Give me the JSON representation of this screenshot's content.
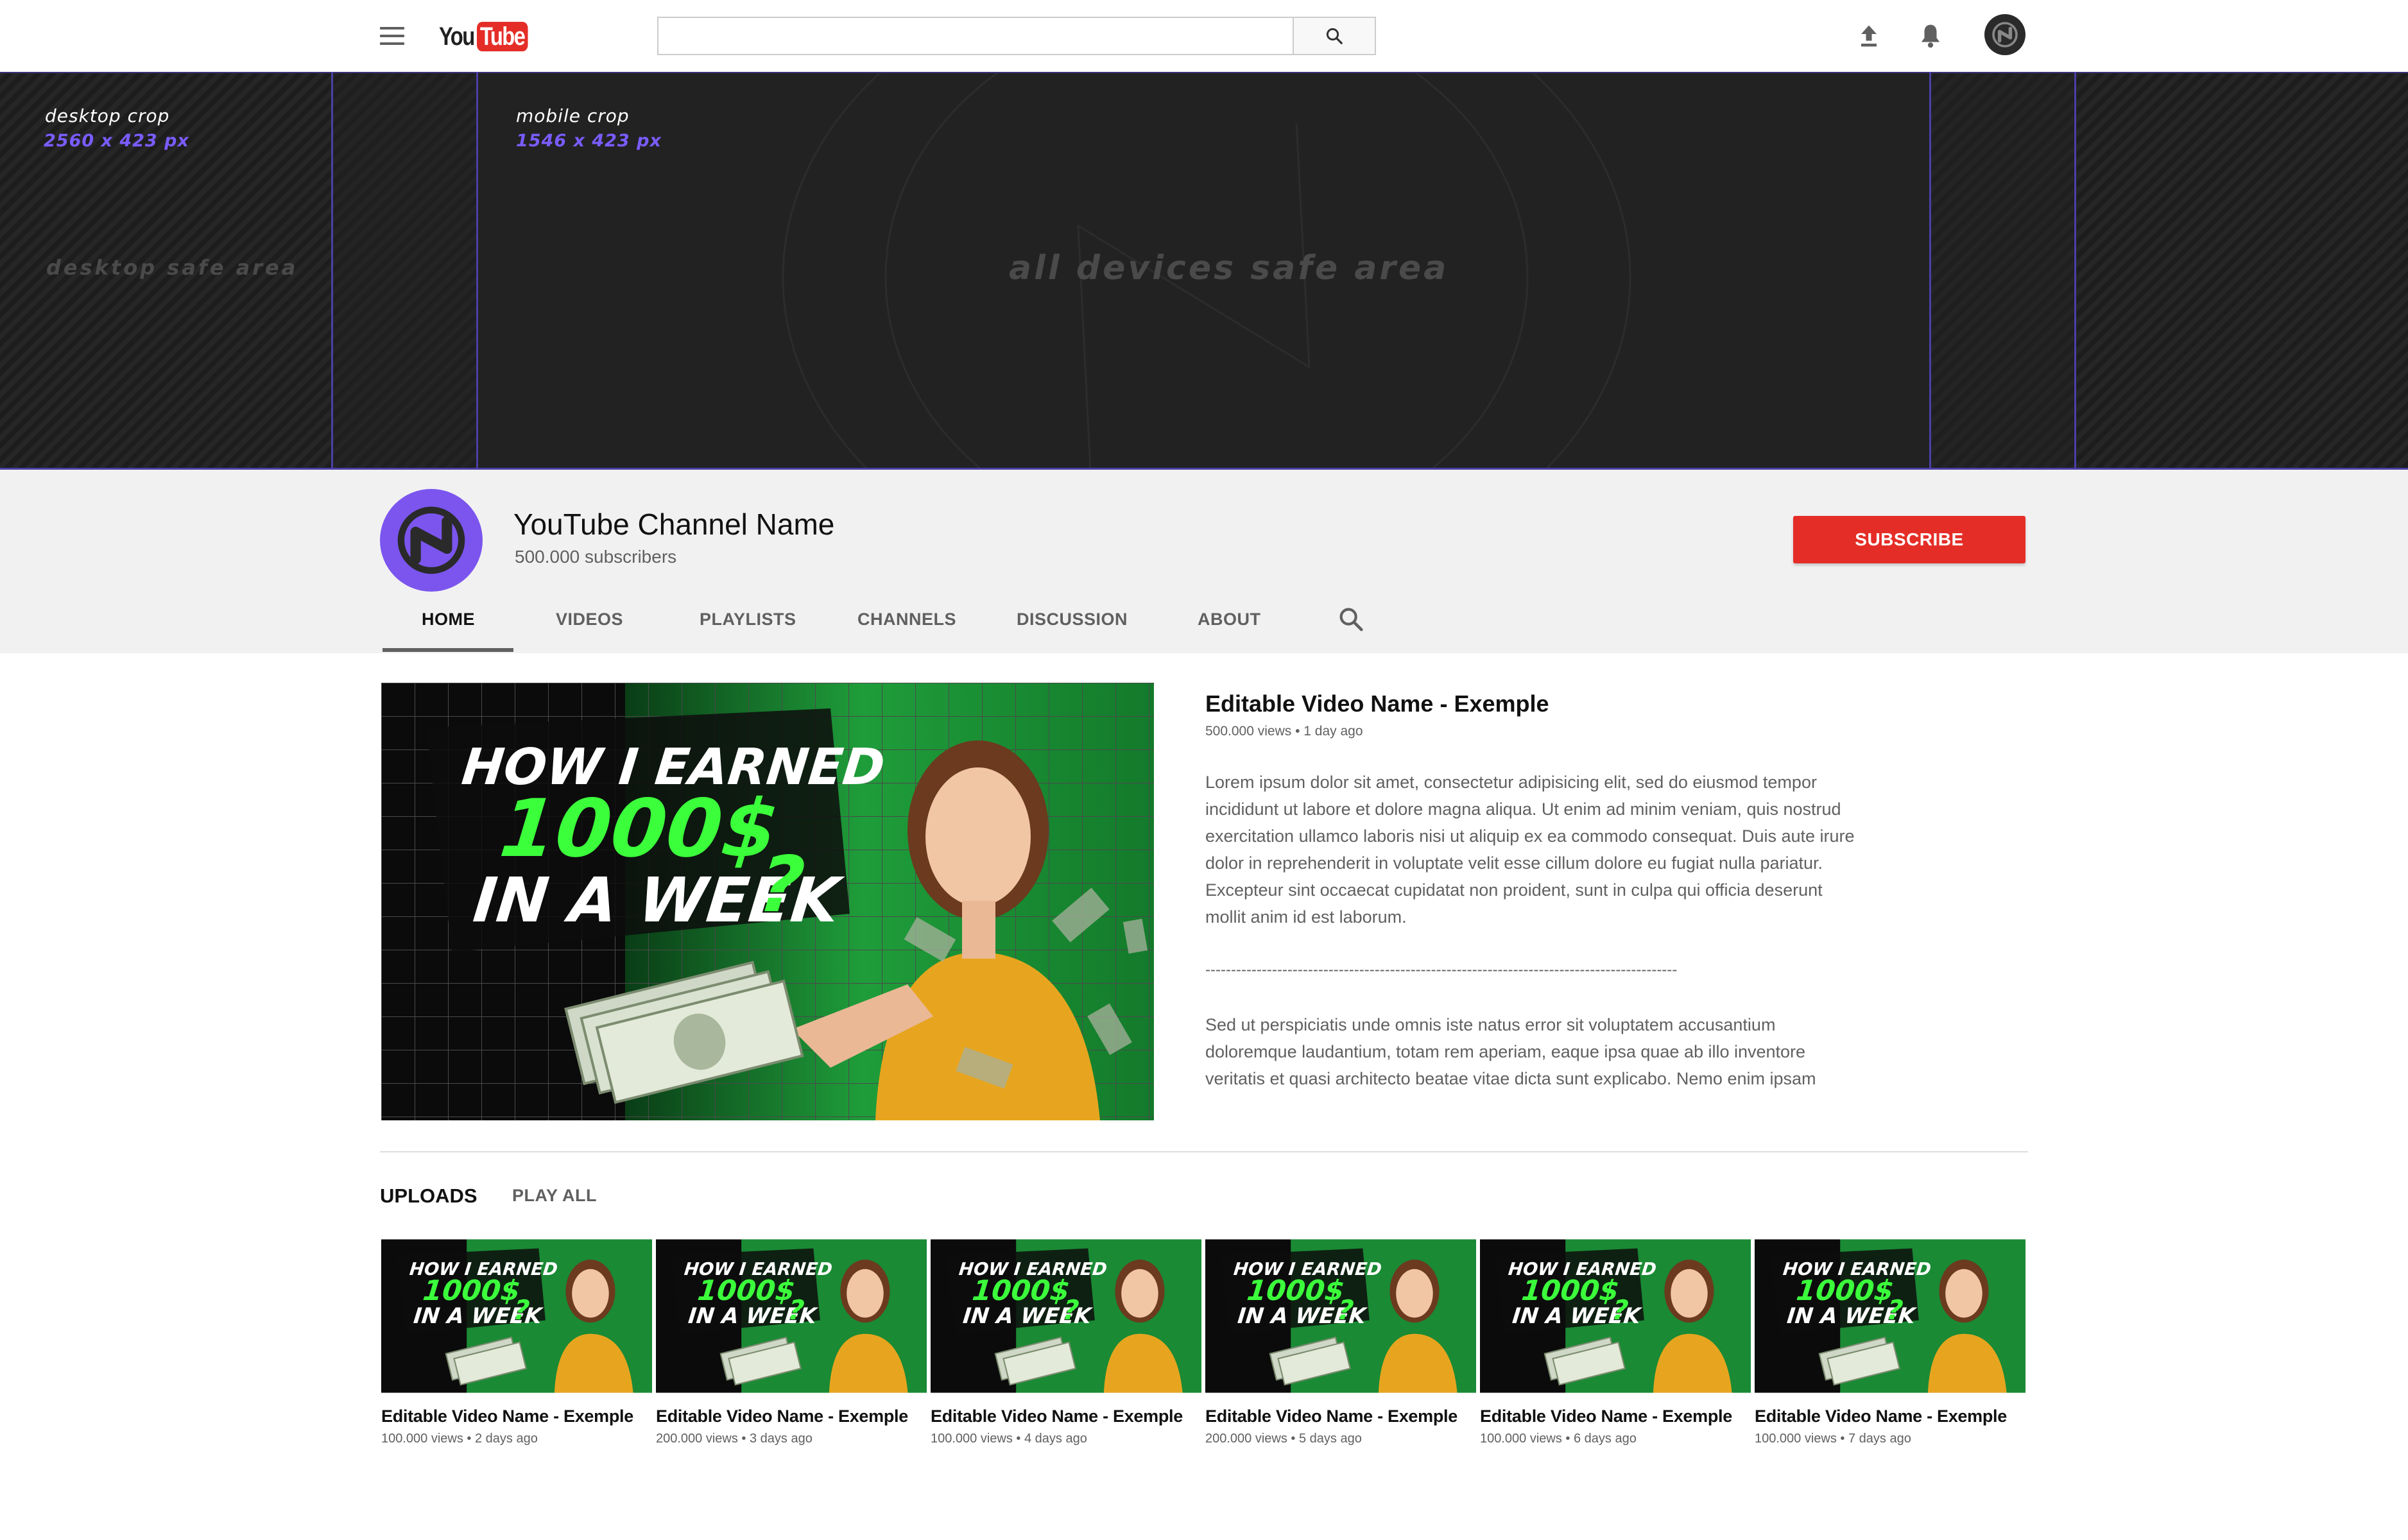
{
  "header": {
    "logo_you": "You",
    "logo_tube": "Tube",
    "search_placeholder": ""
  },
  "banner": {
    "desktop_crop_label": "desktop crop",
    "desktop_crop_size": "2560 x 423 px",
    "mobile_crop_label": "mobile crop",
    "mobile_crop_size": "1546 x 423 px",
    "desktop_safe_label": "desktop safe area",
    "all_devices_safe_label": "all devices safe area"
  },
  "channel": {
    "name": "YouTube Channel Name",
    "subscribers": "500.000 subscribers",
    "subscribe_label": "SUBSCRIBE"
  },
  "tabs": [
    "HOME",
    "VIDEOS",
    "PLAYLISTS",
    "CHANNELS",
    "DISCUSSION",
    "ABOUT"
  ],
  "featured": {
    "title": "Editable Video Name - Exemple",
    "meta": "500.000 views • 1 day ago",
    "description": "Lorem ipsum dolor sit amet, consectetur adipisicing elit, sed do eiusmod tempor incididunt ut labore et dolore magna aliqua. Ut enim ad minim veniam, quis nostrud exercitation ullamco laboris nisi ut aliquip ex ea commodo consequat. Duis aute irure dolor in reprehenderit in voluptate velit esse cillum dolore eu fugiat nulla pariatur. Excepteur sint occaecat cupidatat non proident, sunt in culpa qui officia deserunt mollit anim id est laborum.",
    "separator": "--------------------------------------------------------------------------------------------",
    "description2": "Sed ut perspiciatis unde omnis iste natus error sit voluptatem accusantium doloremque laudantium, totam rem aperiam, eaque ipsa quae ab illo inventore veritatis et quasi architecto beatae vitae dicta sunt explicabo. Nemo enim ipsam",
    "thumb_text": {
      "line1": "HOW I EARNED",
      "line2": "1000$",
      "line3": "IN A WEEK",
      "mark": "?"
    }
  },
  "uploads": {
    "heading": "UPLOADS",
    "play_all": "PLAY ALL",
    "items": [
      {
        "title": "Editable Video Name - Exemple",
        "meta": "100.000 views • 2 days ago"
      },
      {
        "title": "Editable Video Name - Exemple",
        "meta": "200.000 views • 3 days ago"
      },
      {
        "title": "Editable Video Name - Exemple",
        "meta": "100.000 views • 4 days ago"
      },
      {
        "title": "Editable Video Name - Exemple",
        "meta": "200.000 views • 5 days ago"
      },
      {
        "title": "Editable Video Name - Exemple",
        "meta": "100.000 views • 6 days ago"
      },
      {
        "title": "Editable Video Name - Exemple",
        "meta": "100.000 views • 7 days ago"
      }
    ]
  },
  "colors": {
    "brand_red": "#e52d27",
    "crop_accent": "#7a5cff",
    "avatar_purple": "#7b55ee",
    "thumb_green": "#1f9d3a",
    "thumb_accent_green": "#3cff3c",
    "shirt_yellow": "#e7a51f"
  },
  "icons": {
    "menu": "hamburger-menu-icon",
    "search": "magnifier-icon",
    "upload": "upload-arrow-icon",
    "notifications": "bell-icon",
    "avatar": "channel-logo-icon"
  }
}
